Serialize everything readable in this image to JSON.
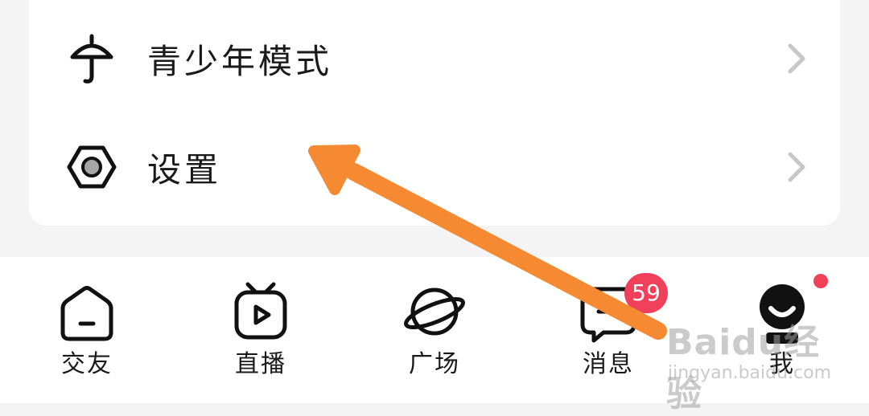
{
  "menu": {
    "items": [
      {
        "label": "青少年模式",
        "icon": "umbrella-icon"
      },
      {
        "label": "设置",
        "icon": "hexagon-settings-icon"
      }
    ]
  },
  "nav": {
    "tabs": [
      {
        "label": "交友",
        "icon": "home-house-icon"
      },
      {
        "label": "直播",
        "icon": "tv-play-icon"
      },
      {
        "label": "广场",
        "icon": "planet-icon"
      },
      {
        "label": "消息",
        "icon": "message-icon"
      },
      {
        "label": "我",
        "icon": "avatar-icon"
      }
    ],
    "message_badge": "59"
  },
  "colors": {
    "badge": "#f0405a",
    "arrow": "#f58a33",
    "background": "#f4f4f4"
  },
  "watermark": {
    "logo": "Baidu经验",
    "url": "jingyan.baidu.com"
  }
}
